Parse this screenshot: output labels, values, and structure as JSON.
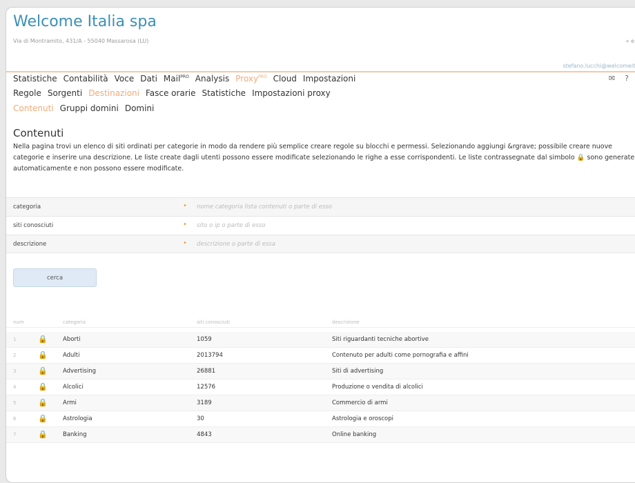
{
  "header": {
    "company": "Welcome Italia spa",
    "address": "Via di Montramito, 431/A - 55040 Massarosa (LU)",
    "corner_mark": "» e",
    "user_email": "stefano.lucchi@welcomeitalia."
  },
  "nav_main": [
    "Statistiche",
    "Contabilità",
    "Voce",
    "Dati",
    "Mail",
    "Analysis",
    "Proxy",
    "Cloud",
    "Impostazioni"
  ],
  "nav_main_sup": {
    "mail": "PRO",
    "proxy": "PRO"
  },
  "top_icons": {
    "mail": "✉",
    "help": "?",
    "exit": "▮"
  },
  "nav_sub": [
    "Regole",
    "Sorgenti",
    "Destinazioni",
    "Fasce orarie",
    "Statistiche",
    "Impostazioni proxy"
  ],
  "nav_sub3": [
    "Contenuti",
    "Gruppi domini",
    "Domini"
  ],
  "page": {
    "title": "Contenuti",
    "desc_1": "Nella pagina trovi un elenco di siti ordinati per categorie in modo da rendere più semplice creare regole su blocchi e permessi. Selezionando aggiungi &rgrave; possibile creare nuove categorie e inserire una descrizione. Le liste create dagli utenti possono essere modificate selezionando le righe a esse corrispondenti. Le liste contrassegnate dal simbolo ",
    "desc_lock": "🔒",
    "desc_2": " sono generate automaticamente e non possono essere modificate."
  },
  "filters": {
    "categoria": {
      "label": "categoria",
      "placeholder": "nome categoria lista contenuti o parte di esso"
    },
    "siti": {
      "label": "siti conosciuti",
      "placeholder": "sito o ip o parte di esso"
    },
    "descrizione": {
      "label": "descrizione",
      "placeholder": "descrizione o parte di essa"
    },
    "bullet": "•"
  },
  "search_button": "cerca",
  "table": {
    "headers": {
      "idx": "num",
      "categoria": "categoria",
      "siti": "siti conosciuti",
      "descrizione": "descrizione"
    },
    "lock_glyph": "🔒",
    "rows": [
      {
        "idx": "1",
        "categoria": "Aborti",
        "siti": "1059",
        "descrizione": "Siti riguardanti tecniche abortive"
      },
      {
        "idx": "2",
        "categoria": "Adulti",
        "siti": "2013794",
        "descrizione": "Contenuto per adulti come pornografia e affini"
      },
      {
        "idx": "3",
        "categoria": "Advertising",
        "siti": "26881",
        "descrizione": "Siti di advertising"
      },
      {
        "idx": "4",
        "categoria": "Alcolici",
        "siti": "12576",
        "descrizione": "Produzione o vendita di alcolici"
      },
      {
        "idx": "5",
        "categoria": "Armi",
        "siti": "3189",
        "descrizione": "Commercio di armi"
      },
      {
        "idx": "6",
        "categoria": "Astrologia",
        "siti": "30",
        "descrizione": "Astrologia e oroscopi"
      },
      {
        "idx": "7",
        "categoria": "Banking",
        "siti": "4843",
        "descrizione": "Online banking"
      }
    ]
  }
}
